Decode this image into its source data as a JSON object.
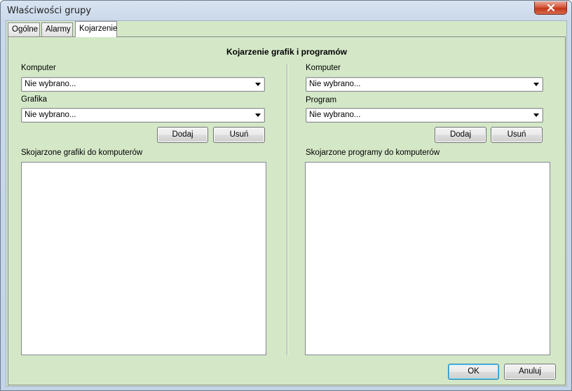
{
  "window": {
    "title": "Właściwości grupy"
  },
  "tabs": [
    {
      "label": "Ogólne"
    },
    {
      "label": "Alarmy"
    },
    {
      "label": "Kojarzenie"
    }
  ],
  "panel": {
    "heading": "Kojarzenie grafik i programów",
    "left": {
      "computer_label": "Komputer",
      "computer_value": "Nie wybrano...",
      "graphic_label": "Grafika",
      "graphic_value": "Nie wybrano...",
      "add_label": "Dodaj",
      "remove_label": "Usuń",
      "list_label": "Skojarzone grafiki do komputerów"
    },
    "right": {
      "computer_label": "Komputer",
      "computer_value": "Nie wybrano...",
      "program_label": "Program",
      "program_value": "Nie wybrano...",
      "add_label": "Dodaj",
      "remove_label": "Usuń",
      "list_label": "Skojarzone programy do komputerów"
    }
  },
  "footer": {
    "ok_label": "OK",
    "cancel_label": "Anuluj"
  },
  "icons": {
    "close": "close-icon"
  },
  "colors": {
    "panel_bg": "#d4e8c8",
    "close_button": "#c5361a",
    "default_button_border": "#3c7fb1"
  }
}
